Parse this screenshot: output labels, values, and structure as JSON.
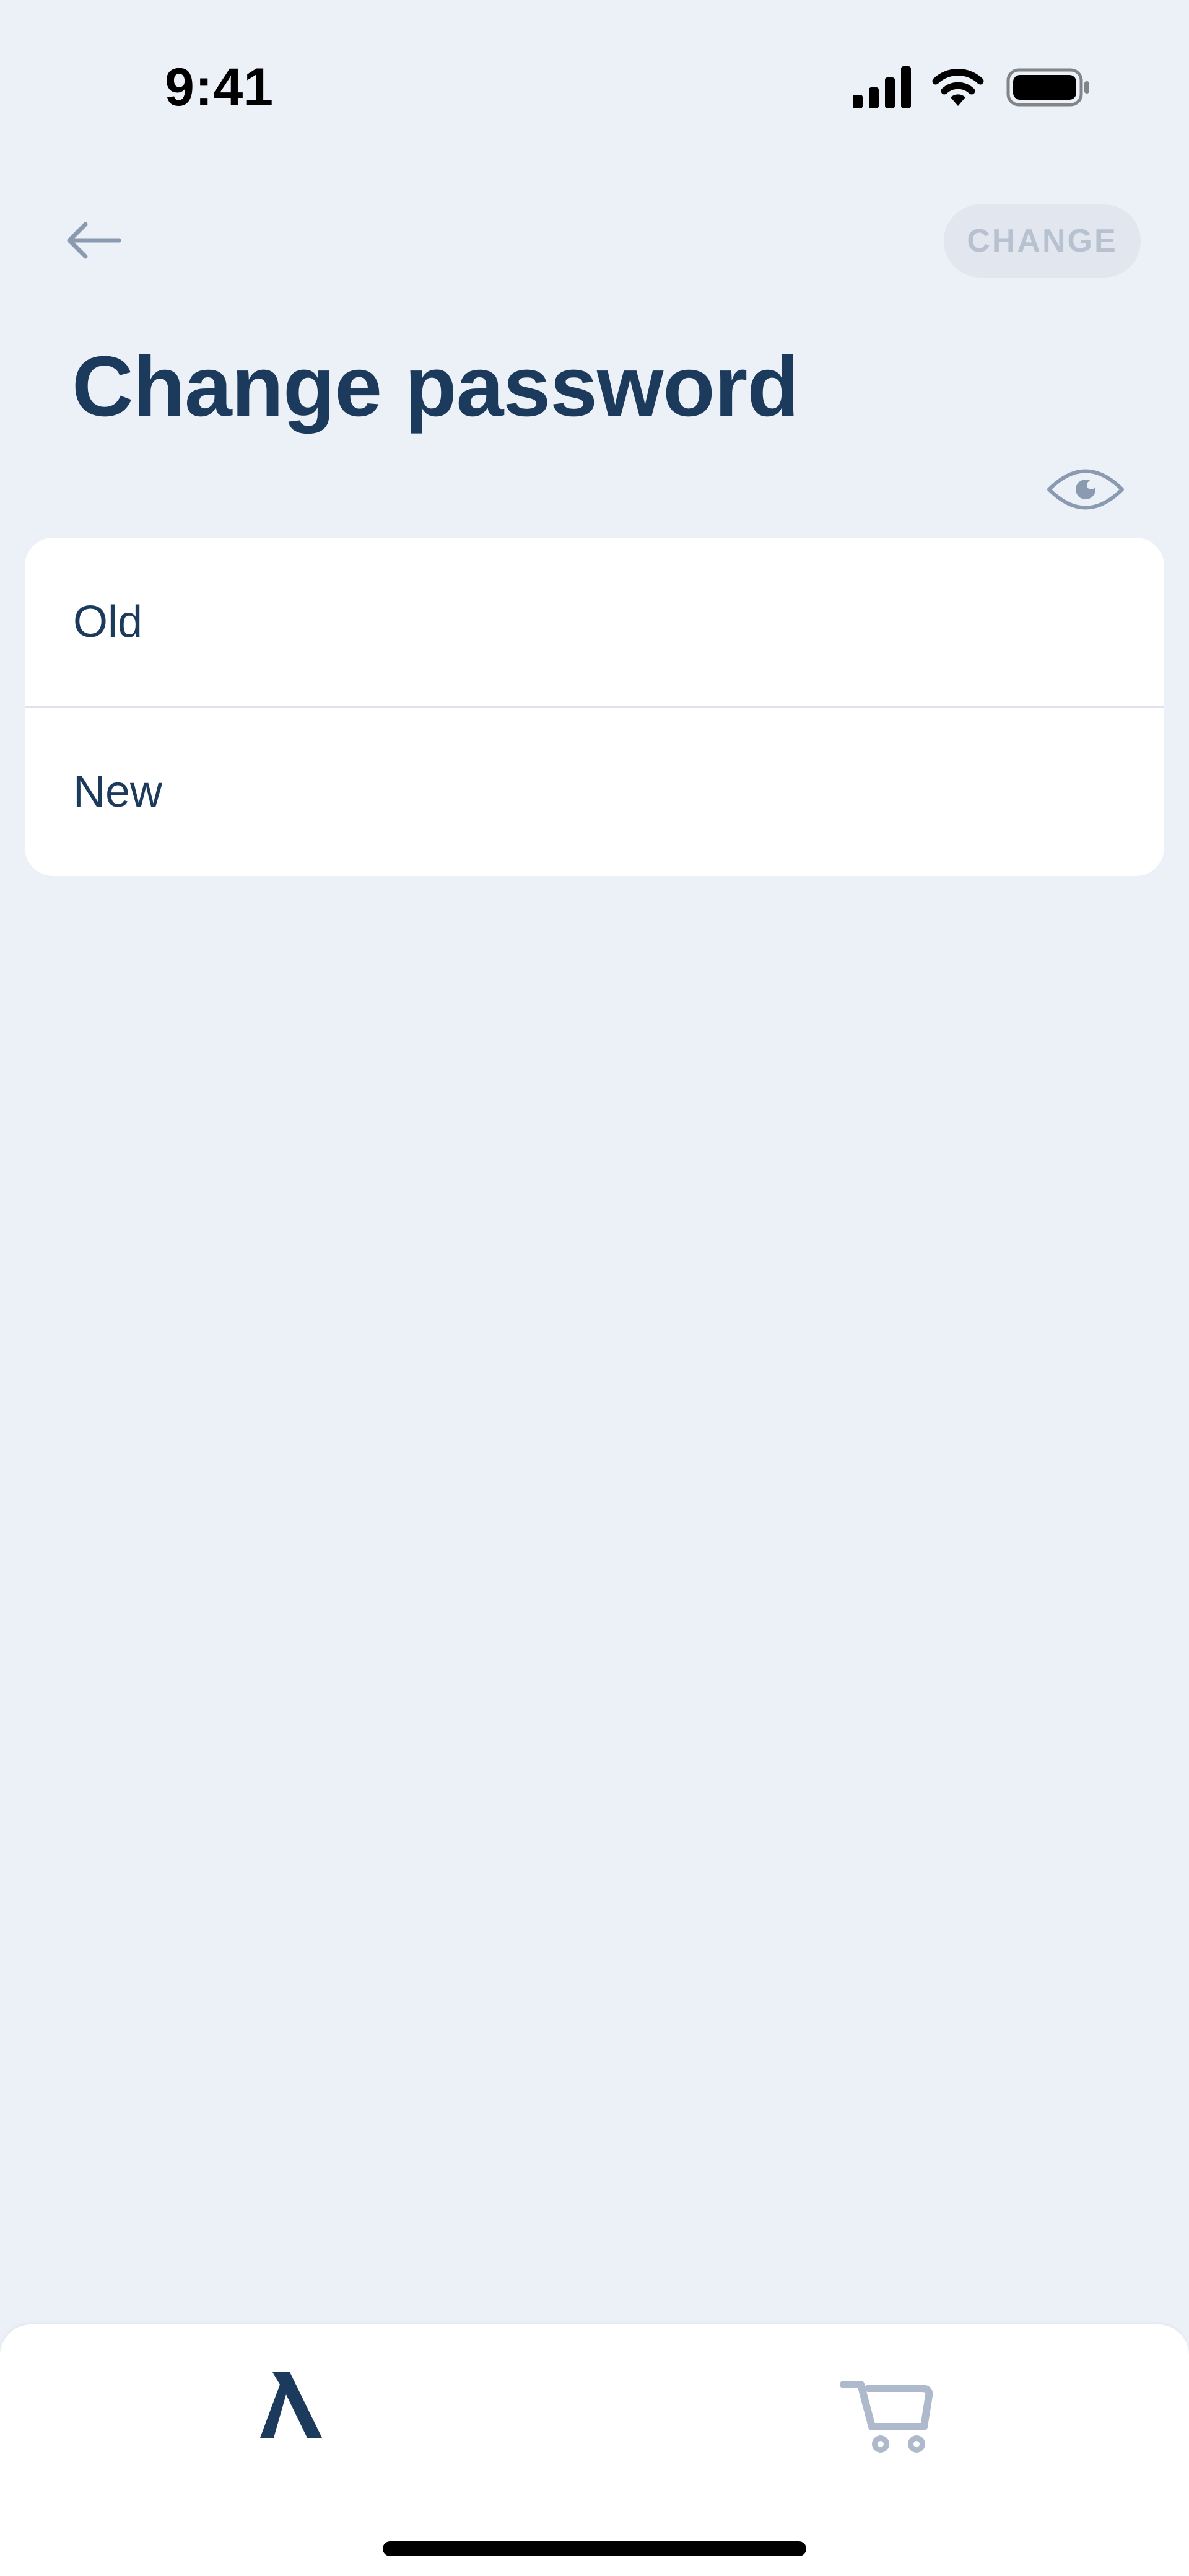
{
  "status_bar": {
    "time": "9:41",
    "icons": [
      "cellular-signal-icon",
      "wifi-icon",
      "battery-icon"
    ]
  },
  "header": {
    "back_icon": "arrow-left-icon",
    "action_label": "CHANGE",
    "title": "Change password",
    "visibility_icon": "eye-icon"
  },
  "form": {
    "fields": [
      {
        "label": "Old",
        "value": ""
      },
      {
        "label": "New",
        "value": ""
      }
    ]
  },
  "tab_bar": {
    "tabs": [
      {
        "icon": "lambda-logo-icon",
        "active": true
      },
      {
        "icon": "cart-icon",
        "active": false
      }
    ]
  },
  "colors": {
    "background": "#ECF0F7",
    "text_primary": "#1B3A5C",
    "icon_muted": "#8A9AB0",
    "disabled_button_bg": "#E2E7EF",
    "disabled_button_text": "#B7C1CF",
    "card": "#FFFFFF"
  }
}
